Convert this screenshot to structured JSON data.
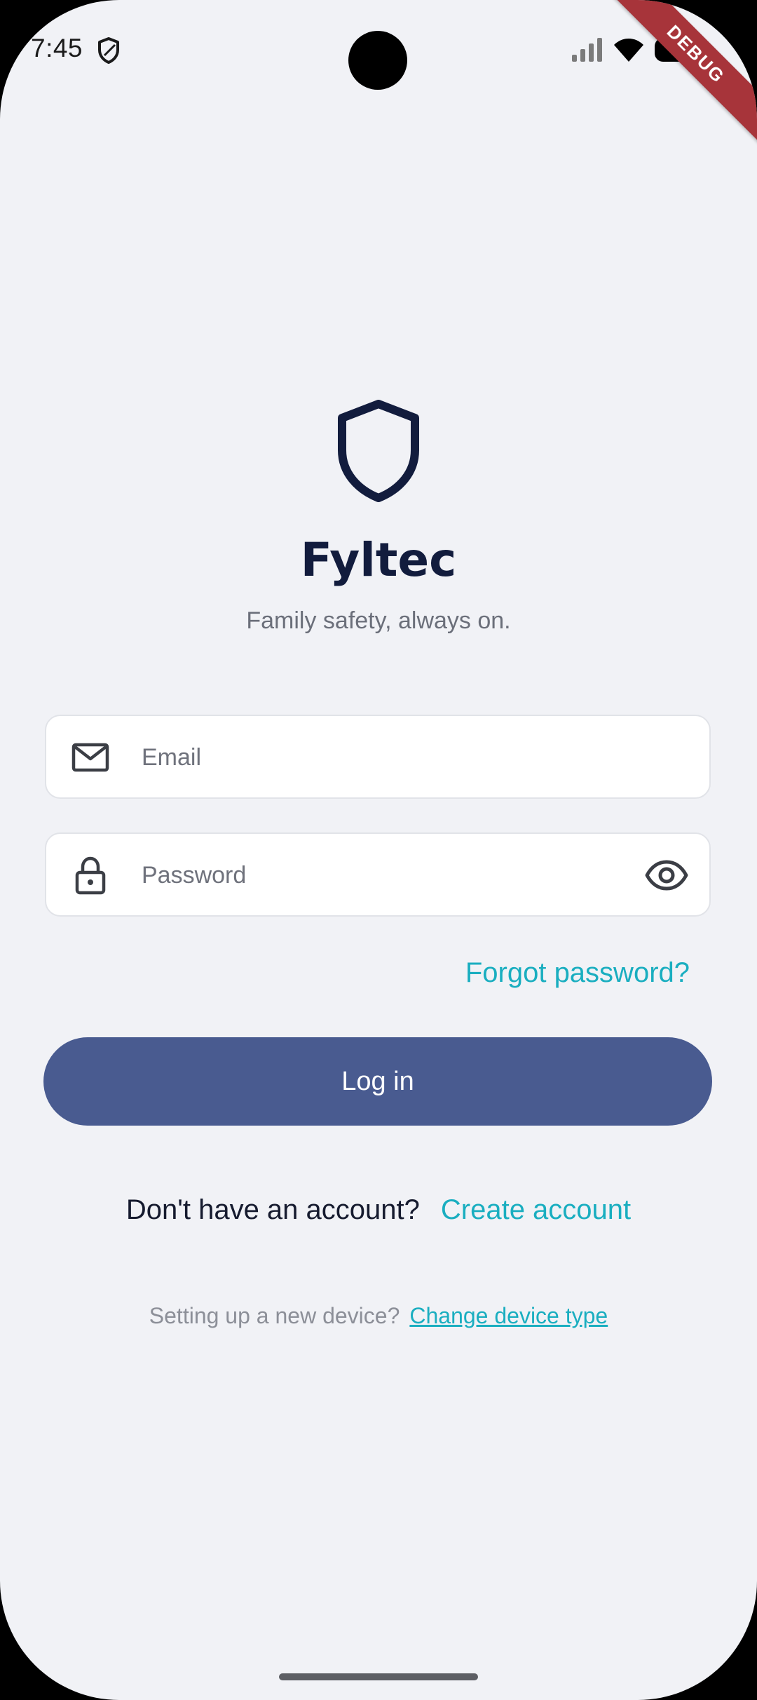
{
  "status_bar": {
    "time": "7:45",
    "debug_label": "DEBUG",
    "icons": [
      "shield-icon",
      "cellular-signal-icon",
      "wifi-icon",
      "battery-icon"
    ]
  },
  "app": {
    "name": "Fyltec",
    "tagline": "Family safety, always on.",
    "logo_icon": "shield-outline-icon",
    "brand_color": "#121c3d"
  },
  "form": {
    "email": {
      "placeholder": "Email",
      "value": "",
      "icon": "mail-icon"
    },
    "password": {
      "placeholder": "Password",
      "value": "",
      "icon": "lock-icon",
      "toggle_icon": "eye-icon"
    },
    "forgot_label": "Forgot password?",
    "login_label": "Log in"
  },
  "signup": {
    "prompt": "Don't have an account?",
    "link": "Create account"
  },
  "device": {
    "prompt": "Setting up a new device?",
    "link": "Change device type"
  },
  "colors": {
    "accent": "#1aaec0",
    "primary_button": "#495b90",
    "background": "#f1f2f6",
    "debug_ribbon": "#a7343a"
  }
}
